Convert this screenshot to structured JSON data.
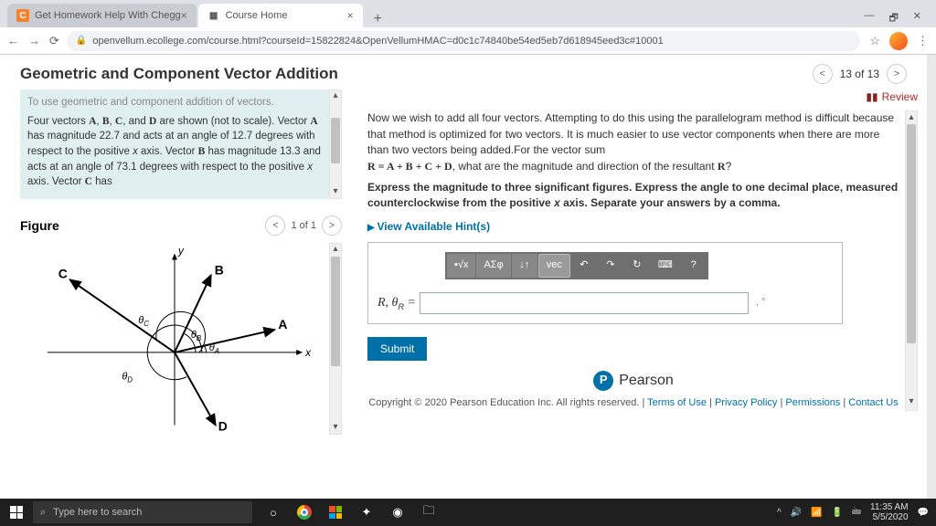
{
  "browser": {
    "tabs": [
      {
        "icon": "C",
        "icon_bg": "#f58232",
        "label": "Get Homework Help With Chegg"
      },
      {
        "icon": "▦",
        "icon_bg": "#555",
        "label": "Course Home"
      }
    ],
    "url": "openvellum.ecollege.com/course.html?courseId=15822824&OpenVellumHMAC=d0c1c74840be54ed5eb7d618945eed3c#10001",
    "window_controls": {
      "min": "—",
      "max": "🗗",
      "close": "✕"
    }
  },
  "page": {
    "title": "Geometric and Component Vector Addition",
    "counter": "13 of 13",
    "review": "Review"
  },
  "intro": {
    "faded": "To use geometric and component addition of vectors.",
    "body_prefix": "Four vectors ",
    "body_mid": " are shown (not to scale). Vector ",
    "body_a": " has magnitude 22.7 and acts at an angle of 12.7 degrees with respect to the positive ",
    "body_a2": " axis. Vector ",
    "body_b": " has magnitude 13.3 and acts at an angle of 73.1 degrees with respect to the positive ",
    "body_b2": " axis. Vector ",
    "body_c": " has",
    "vec_a": "A",
    "vec_b": "B",
    "vec_c": "C",
    "vec_d": "D",
    "vec_sep": ", ",
    "vec_and": ", and ",
    "axis_x": "x"
  },
  "figure": {
    "label": "Figure",
    "pager": "1 of 1",
    "labels": {
      "y": "y",
      "x": "x",
      "A": "A",
      "B": "B",
      "C": "C",
      "D": "D",
      "tA": "θA",
      "tB": "θB",
      "tC": "θC",
      "tD": "θD"
    }
  },
  "problem": {
    "p1": "Now we wish to add all four vectors. Attempting to do this using the parallelogram method is difficult because that method is optimized for two vectors. It is much easier to use vector components when there are more than two vectors being added.For the vector sum",
    "eq": "R = A + B + C + D",
    "p1b": ", what are the magnitude and direction of the resultant ",
    "p1c": "?",
    "resR": "R",
    "p2": "Express the magnitude to three significant figures. Express the angle to one decimal place, measured counterclockwise from the positive ",
    "p2x": "x",
    "p2b": " axis. Separate your answers by a comma.",
    "hints": "View Available Hint(s)",
    "var_label": "R, θR =",
    "unit_hint": ", °",
    "submit": "Submit",
    "toolbar": {
      "t1": "▪√x",
      "t2": "ΑΣφ",
      "t3": "↓↑",
      "t4": "vec",
      "t5": "↶",
      "t6": "↷",
      "t7": "↻",
      "t8": "⌨",
      "t9": "?"
    }
  },
  "brand": {
    "p": "P",
    "name": "Pearson"
  },
  "footer": {
    "copyright": "Copyright © 2020 Pearson Education Inc. All rights reserved.",
    "links": [
      "Terms of Use",
      "Privacy Policy",
      "Permissions",
      "Contact Us"
    ]
  },
  "taskbar": {
    "search_placeholder": "Type here to search",
    "time": "11:35 AM",
    "date": "5/5/2020"
  }
}
